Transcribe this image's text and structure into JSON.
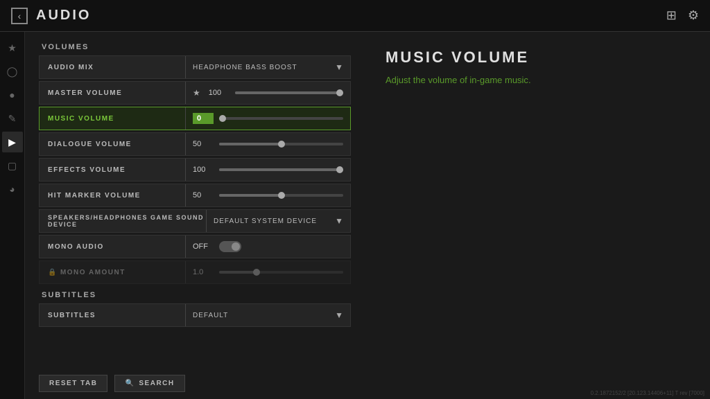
{
  "header": {
    "title": "AUDIO",
    "back_icon": "‹",
    "grid_icon": "⊞",
    "gear_icon": "⚙"
  },
  "sidebar": {
    "icons": [
      {
        "name": "star-icon",
        "glyph": "★",
        "active": false
      },
      {
        "name": "person-icon",
        "glyph": "👤",
        "active": false
      },
      {
        "name": "controller-icon",
        "glyph": "🎮",
        "active": false
      },
      {
        "name": "pencil-icon",
        "glyph": "✎",
        "active": false
      },
      {
        "name": "audio-icon",
        "glyph": "🔊",
        "active": true
      },
      {
        "name": "grid-icon",
        "glyph": "▦",
        "active": false
      },
      {
        "name": "satellite-icon",
        "glyph": "◎",
        "active": false
      }
    ]
  },
  "sections": {
    "volumes_label": "VOLUMES",
    "subtitles_label": "SUBTITLES",
    "rows": [
      {
        "id": "audio-mix",
        "label": "AUDIO MIX",
        "type": "dropdown",
        "value": "HEADPHONE BASS BOOST",
        "active": false,
        "disabled": false
      },
      {
        "id": "master-volume",
        "label": "MASTER VOLUME",
        "type": "slider",
        "value": "100",
        "fill_pct": 100,
        "has_star": true,
        "active": false,
        "disabled": false
      },
      {
        "id": "music-volume",
        "label": "MUSIC VOLUME",
        "type": "slider",
        "value": "0",
        "fill_pct": 0,
        "active": true,
        "disabled": false
      },
      {
        "id": "dialogue-volume",
        "label": "DIALOGUE VOLUME",
        "type": "slider",
        "value": "50",
        "fill_pct": 50,
        "active": false,
        "disabled": false
      },
      {
        "id": "effects-volume",
        "label": "EFFECTS VOLUME",
        "type": "slider",
        "value": "100",
        "fill_pct": 100,
        "active": false,
        "disabled": false
      },
      {
        "id": "hit-marker-volume",
        "label": "HIT MARKER VOLUME",
        "type": "slider",
        "value": "50",
        "fill_pct": 50,
        "active": false,
        "disabled": false
      },
      {
        "id": "speakers-device",
        "label": "SPEAKERS/HEADPHONES GAME SOUND DEVICE",
        "type": "dropdown",
        "value": "DEFAULT SYSTEM DEVICE",
        "active": false,
        "disabled": false
      },
      {
        "id": "mono-audio",
        "label": "MONO AUDIO",
        "type": "toggle",
        "value": "OFF",
        "active": false,
        "disabled": false
      },
      {
        "id": "mono-amount",
        "label": "MONO AMOUNT",
        "type": "slider",
        "value": "1.0",
        "fill_pct": 30,
        "active": false,
        "disabled": true
      }
    ],
    "subtitle_rows": [
      {
        "id": "subtitles",
        "label": "SUBTITLES",
        "type": "dropdown",
        "value": "DEFAULT",
        "active": false,
        "disabled": false
      }
    ]
  },
  "info_panel": {
    "title": "MUSIC VOLUME",
    "description_pre": "Adjust the volume of ",
    "description_link": "in-game music",
    "description_post": "."
  },
  "bottom": {
    "reset_label": "RESET TAB",
    "search_label": "SEARCH",
    "search_icon": "🔍"
  },
  "version": "0.2.1872152/2 [20.123.14406+11] T rev [7000]"
}
